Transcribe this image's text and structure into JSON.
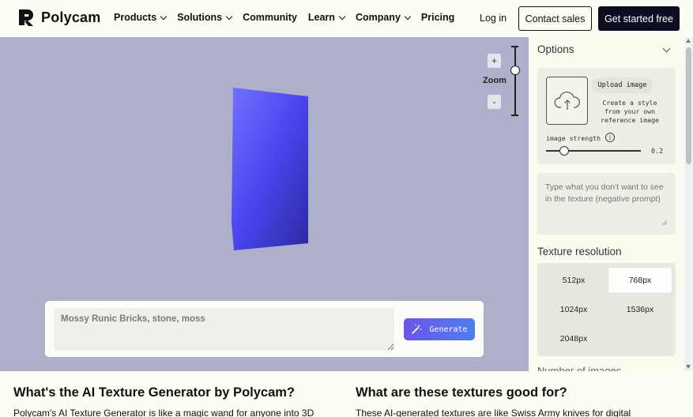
{
  "header": {
    "logo_text": "Polycam",
    "nav": [
      {
        "label": "Products",
        "dropdown": true
      },
      {
        "label": "Solutions",
        "dropdown": true
      },
      {
        "label": "Community",
        "dropdown": false
      },
      {
        "label": "Learn",
        "dropdown": true
      },
      {
        "label": "Company",
        "dropdown": true
      },
      {
        "label": "Pricing",
        "dropdown": false
      }
    ],
    "login": "Log in",
    "contact_sales": "Contact sales",
    "get_started": "Get started free"
  },
  "viewport": {
    "zoom_label": "Zoom",
    "zoom_plus": "+",
    "zoom_minus": "-",
    "zoom_level": 0.65,
    "prompt_value": "Mossy Runic Bricks, stone, moss",
    "generate_label": "Generate"
  },
  "options": {
    "title": "Options",
    "upload_label": "Upload image",
    "upload_desc": "Create a style from your own reference image",
    "strength_label": "image strength",
    "strength_value": "0.2",
    "negative_placeholder": "Type what you don't want to see in the texture (negative prompt)",
    "resolution_title": "Texture resolution",
    "resolutions": [
      "512px",
      "768px",
      "1024px",
      "1536px",
      "2048px"
    ],
    "selected_resolution": "768px",
    "num_images_label": "Number of images"
  },
  "bottom": {
    "left_heading": "What's the AI Texture Generator by Polycam?",
    "left_text": "Polycam's AI Texture Generator is like a magic wand for anyone into 3D",
    "right_heading": "What are these textures good for?",
    "right_text": "These AI-generated textures are like Swiss Army knives for digital"
  },
  "colors": {
    "viewport_bg": "#aeb0cb",
    "cube_light": "#6b6bff",
    "cube_dark": "#2a2aa8",
    "generate_gradient": [
      "#6b55e8",
      "#4f7ef2"
    ],
    "primary_button": "#0d0d22"
  },
  "icons": {
    "logo": "polycam-logo-icon",
    "upload": "cloud-upload-icon",
    "info": "info-icon",
    "generate": "magic-wand-icon"
  }
}
